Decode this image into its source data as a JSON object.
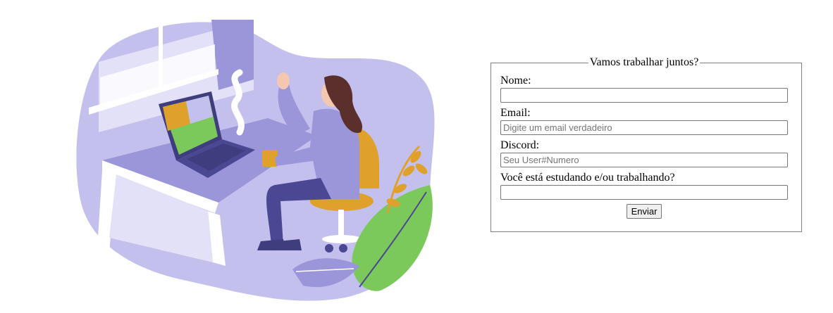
{
  "illustration": {
    "name": "video-call-illustration"
  },
  "form": {
    "legend": "Vamos trabalhar juntos?",
    "fields": [
      {
        "label": "Nome:",
        "value": "",
        "placeholder": ""
      },
      {
        "label": "Email:",
        "value": "",
        "placeholder": "Digite um email verdadeiro"
      },
      {
        "label": "Discord:",
        "value": "",
        "placeholder": "Seu User#Numero"
      },
      {
        "label": "Você está estudando e/ou trabalhando?",
        "value": "",
        "placeholder": ""
      }
    ],
    "submit_label": "Enviar"
  },
  "colors": {
    "purple_light": "#c3c0ee",
    "purple_mid": "#9b96d9",
    "purple_dark": "#4b4893",
    "orange": "#e0a12c",
    "green": "#7bc95a",
    "skin": "#f4c7b0",
    "hair": "#5a2f2c"
  }
}
